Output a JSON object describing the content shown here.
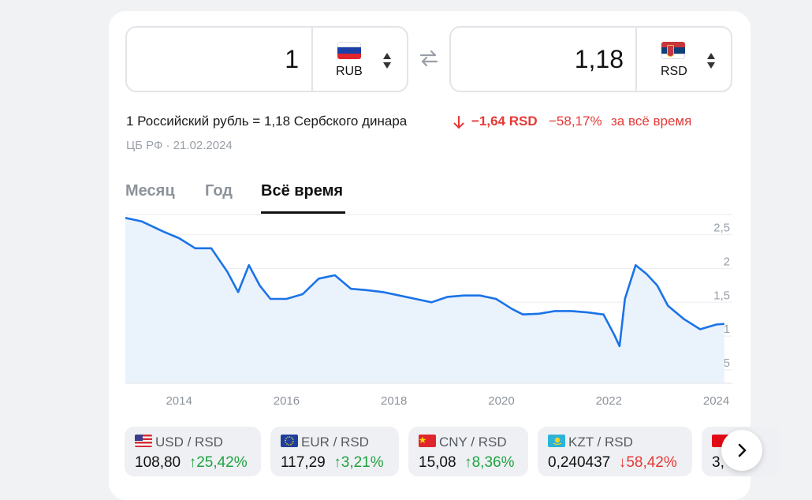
{
  "converter": {
    "from": {
      "amount": "1",
      "currency": "RUB"
    },
    "to": {
      "amount": "1,18",
      "currency": "RSD"
    }
  },
  "summary": {
    "rate_text": "1 Российский рубль = 1,18 Сербского динара",
    "change_abs": "−1,64 RSD",
    "change_pct": "−58,17%",
    "change_period": "за всё время",
    "source": "ЦБ РФ · 21.02.2024"
  },
  "tabs": [
    {
      "label": "Месяц",
      "active": false
    },
    {
      "label": "Год",
      "active": false
    },
    {
      "label": "Всё время",
      "active": true
    }
  ],
  "chart_data": {
    "type": "area",
    "x": [
      2013.0,
      2013.3,
      2013.7,
      2014.0,
      2014.3,
      2014.6,
      2014.9,
      2015.1,
      2015.3,
      2015.5,
      2015.7,
      2016.0,
      2016.3,
      2016.6,
      2016.9,
      2017.2,
      2017.5,
      2017.8,
      2018.1,
      2018.4,
      2018.7,
      2019.0,
      2019.3,
      2019.6,
      2019.9,
      2020.2,
      2020.4,
      2020.7,
      2021.0,
      2021.3,
      2021.6,
      2021.9,
      2022.1,
      2022.2,
      2022.3,
      2022.5,
      2022.7,
      2022.9,
      2023.1,
      2023.4,
      2023.7,
      2024.0,
      2024.15
    ],
    "y": [
      2.75,
      2.7,
      2.55,
      2.45,
      2.3,
      2.3,
      1.95,
      1.65,
      2.05,
      1.75,
      1.55,
      1.55,
      1.62,
      1.85,
      1.9,
      1.7,
      1.68,
      1.65,
      1.6,
      1.55,
      1.5,
      1.58,
      1.6,
      1.6,
      1.55,
      1.4,
      1.32,
      1.33,
      1.37,
      1.37,
      1.35,
      1.32,
      1.02,
      0.85,
      1.55,
      2.05,
      1.92,
      1.75,
      1.45,
      1.25,
      1.1,
      1.17,
      1.18
    ],
    "yticks": [
      "2,5",
      "2",
      "1,5",
      "1",
      "0,5"
    ],
    "yvals": [
      2.5,
      2.0,
      1.5,
      1.0,
      0.5
    ],
    "xticks": [
      "2014",
      "2016",
      "2018",
      "2020",
      "2022",
      "2024"
    ],
    "xvals": [
      2014,
      2016,
      2018,
      2020,
      2022,
      2024
    ],
    "ylim": [
      0.3,
      2.8
    ],
    "xlim": [
      2013.0,
      2024.3
    ],
    "color": "#1a73e8",
    "fill": "#eaf2fc",
    "grid": true
  },
  "pairs": [
    {
      "pair": "USD / RSD",
      "value": "108,80",
      "change": "25,42%",
      "dir": "up"
    },
    {
      "pair": "EUR / RSD",
      "value": "117,29",
      "change": "3,21%",
      "dir": "up"
    },
    {
      "pair": "CNY / RSD",
      "value": "15,08",
      "change": "8,36%",
      "dir": "up"
    },
    {
      "pair": "KZT / RSD",
      "value": "0,240437",
      "change": "58,42%",
      "dir": "down"
    },
    {
      "pair": "",
      "value": "3,",
      "change": "",
      "dir": "up"
    }
  ],
  "colors": {
    "up": "#1ea341",
    "down": "#e53935",
    "accent": "#1a73e8"
  }
}
